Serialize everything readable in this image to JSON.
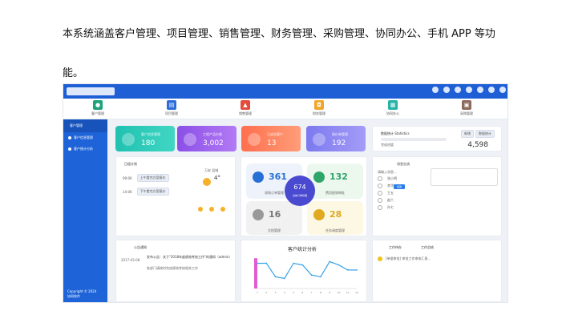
{
  "intro": {
    "line1": "本系统涵盖客户管理、项目管理、销售管理、财务管理、采购管理、协同办公、手机 APP 等功",
    "line2": "能。"
  },
  "colors": {
    "primary": "#1f5fd6",
    "sidebar": "#1e63d8",
    "teal": "#23c0b0",
    "purple": "#8a4fe6",
    "coral": "#ff7a5a",
    "violet": "#7f7ff0"
  },
  "modules": [
    {
      "label": "客户管理",
      "color": "#1ea37b",
      "icon": "customer-icon"
    },
    {
      "label": "项目管理",
      "color": "#2c6dd9",
      "icon": "project-icon"
    },
    {
      "label": "销售管理",
      "color": "#e34b3c",
      "icon": "sales-icon"
    },
    {
      "label": "财务管理",
      "color": "#f2a62a",
      "icon": "finance-icon"
    },
    {
      "label": "协同办公",
      "color": "#24b3a6",
      "icon": "office-icon"
    },
    {
      "label": "采购管理",
      "color": "#8d6a5b",
      "icon": "purchase-icon"
    }
  ],
  "sidebar": {
    "title": "客户管理",
    "items": [
      {
        "label": "客户信息管理"
      },
      {
        "label": "客户统计分析"
      }
    ],
    "copyright": "Copyright © 2024",
    "company": "协同软件"
  },
  "cards": [
    {
      "title": "客户信息管理",
      "value": "180"
    },
    {
      "title": "工程产品价格",
      "value": "3,002"
    },
    {
      "title": "已成交客户",
      "value": "13"
    },
    {
      "title": "报价单管理",
      "value": "192"
    }
  ],
  "statistics": {
    "title": "数据统计 Statistics",
    "btn1": "新增",
    "btn2": "数据统计",
    "caption": "完成进度",
    "value": "4,598"
  },
  "schedule": {
    "title": "日程计划",
    "items": [
      {
        "time": "09:00",
        "text": "上午看完方案报价"
      },
      {
        "time": "14:00",
        "text": "下午看完方案报价"
      }
    ],
    "weather": {
      "city": "万安 县城",
      "temp": "4°"
    }
  },
  "overview": {
    "total": "674",
    "total_label": "总体订单管理",
    "items": [
      {
        "value": "361",
        "label": "采购订单管理",
        "color": "#2870d6"
      },
      {
        "value": "132",
        "label": "费用报销审批",
        "color": "#2fa56a"
      },
      {
        "value": "16",
        "label": "文档管理",
        "color": "#777777"
      },
      {
        "value": "28",
        "label": "任务调度管理",
        "color": "#e0a91f"
      }
    ]
  },
  "messages": {
    "title": "消息交流",
    "placeholder": "请输入消息...",
    "send": "发送",
    "contacts": [
      "张小明",
      "李华",
      "王五",
      "赵六",
      "孙七"
    ]
  },
  "notice": {
    "title": "公告通知",
    "date": "2017-03-08",
    "text": "发布公告：关于\"2018年度绩效考核工作\"的通知（admin）",
    "extra": "各部门请按时完成绩效考核相关工作"
  },
  "chart_title": "客户统计分析",
  "todo": {
    "title": "工作待办",
    "tab2": "工作总结",
    "item": "[单据审批] 审批工作审核汇报..."
  },
  "chart_data": {
    "type": "line",
    "title": "客户统计分析",
    "categories": [
      "1",
      "2",
      "3",
      "4",
      "5",
      "6",
      "7",
      "8",
      "9",
      "10",
      "11",
      "12"
    ],
    "series": [
      {
        "name": "",
        "values": [
          150,
          150,
          70,
          60,
          150,
          140,
          80,
          70,
          160,
          140,
          110,
          110
        ]
      }
    ],
    "bar_values": [
      180
    ],
    "ylim": [
      0,
      200
    ]
  }
}
